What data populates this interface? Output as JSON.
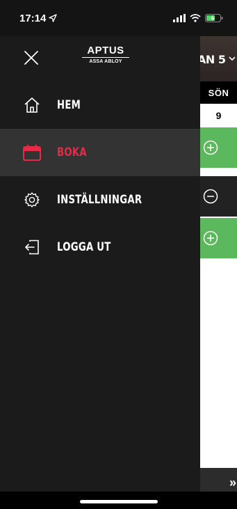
{
  "status_bar": {
    "time": "17:14",
    "icons": [
      "location-arrow-icon",
      "signal-icon",
      "wifi-icon",
      "battery-charging-icon"
    ]
  },
  "drawer": {
    "close_icon": "close-icon",
    "logo": {
      "main": "APTUS",
      "sub": "ASSA ABLOY"
    },
    "menu": [
      {
        "label": "HEM",
        "icon": "home-icon",
        "active": false
      },
      {
        "label": "BOKA",
        "icon": "calendar-icon",
        "active": true
      },
      {
        "label": "INSTÄLLNINGAR",
        "icon": "gear-icon",
        "active": false
      },
      {
        "label": "LOGGA UT",
        "icon": "logout-icon",
        "active": false
      }
    ]
  },
  "background_content": {
    "title_fragment": "AN 5",
    "day_label": "SÖN",
    "date_label": "9",
    "slots": [
      {
        "state": "available",
        "icon": "plus-circle-icon"
      },
      {
        "state": "booked",
        "icon": "minus-circle-icon"
      },
      {
        "state": "available",
        "icon": "plus-circle-icon"
      }
    ],
    "next_arrows": "»"
  },
  "colors": {
    "drawer_bg": "#1b1b1b",
    "active_bg": "#333333",
    "accent_red": "#e52b46",
    "slot_green": "#5cb85c",
    "slot_dark": "#222222"
  }
}
